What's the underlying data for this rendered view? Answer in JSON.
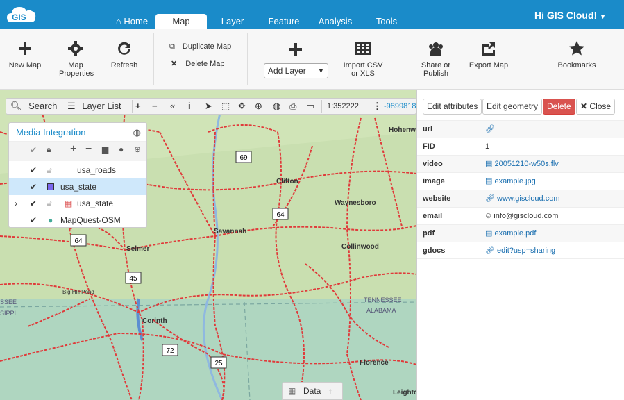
{
  "nav": {
    "logo_text": "GIS",
    "tabs": [
      "Home",
      "Map",
      "Layer",
      "Feature",
      "Analysis",
      "Tools"
    ],
    "active_tab": "Map",
    "greeting": "Hi GIS Cloud!"
  },
  "ribbon": {
    "new_map": "New Map",
    "map_properties": "Map Properties",
    "refresh": "Refresh",
    "duplicate_map": "Duplicate Map",
    "delete_map": "Delete Map",
    "add_layer": "Add Layer",
    "import_csv": "Import CSV or XLS",
    "share_publish": "Share or Publish",
    "export_map": "Export Map",
    "bookmarks": "Bookmarks"
  },
  "toolbar": {
    "search": "Search",
    "layer_list": "Layer List",
    "scale": "1:352222",
    "coords": "-9899818.",
    "tool_icons": [
      "plus-icon",
      "minus-icon",
      "collapse-icon",
      "info-icon",
      "pointer-icon",
      "select-box-icon",
      "pan-icon",
      "zoom-icon",
      "globe-icon",
      "print-icon",
      "measure-icon",
      "more-icon"
    ]
  },
  "layers": {
    "title": "Media Integration",
    "items": [
      {
        "name": "usa_roads",
        "checked": true,
        "locked": true
      },
      {
        "name": "usa_state",
        "checked": true,
        "selected": true,
        "swatch": "#7b68ee"
      },
      {
        "name": "usa_state",
        "checked": true,
        "locked": true,
        "expandable": true
      },
      {
        "name": "MapQuest-OSM",
        "checked": true,
        "globe": true
      }
    ]
  },
  "attributes": {
    "buttons": {
      "edit_attributes": "Edit attributes",
      "edit_geometry": "Edit geometry",
      "delete": "Delete",
      "close": "Close"
    },
    "rows": [
      {
        "key": "url",
        "value": ""
      },
      {
        "key": "FID",
        "value": "1"
      },
      {
        "key": "video",
        "value": "20051210-w50s.flv"
      },
      {
        "key": "image",
        "value": "example.jpg"
      },
      {
        "key": "website",
        "value": "www.giscloud.com"
      },
      {
        "key": "email",
        "value": "info@giscloud.com"
      },
      {
        "key": "pdf",
        "value": "example.pdf"
      },
      {
        "key": "gdocs",
        "value": "edit?usp=sharing"
      }
    ]
  },
  "map": {
    "places": [
      "Clifton",
      "Waynesboro",
      "Savannah",
      "Selmer",
      "Collinwood",
      "Big Hill Pond",
      "Corinth",
      "Florence",
      "Hohenwald",
      "Leighton",
      "TENNESSEE",
      "ALABAMA",
      "SSEE",
      "SIPPI"
    ],
    "shields": [
      "69",
      "64",
      "64",
      "45",
      "72",
      "25"
    ]
  },
  "data_tab": {
    "label": "Data"
  }
}
